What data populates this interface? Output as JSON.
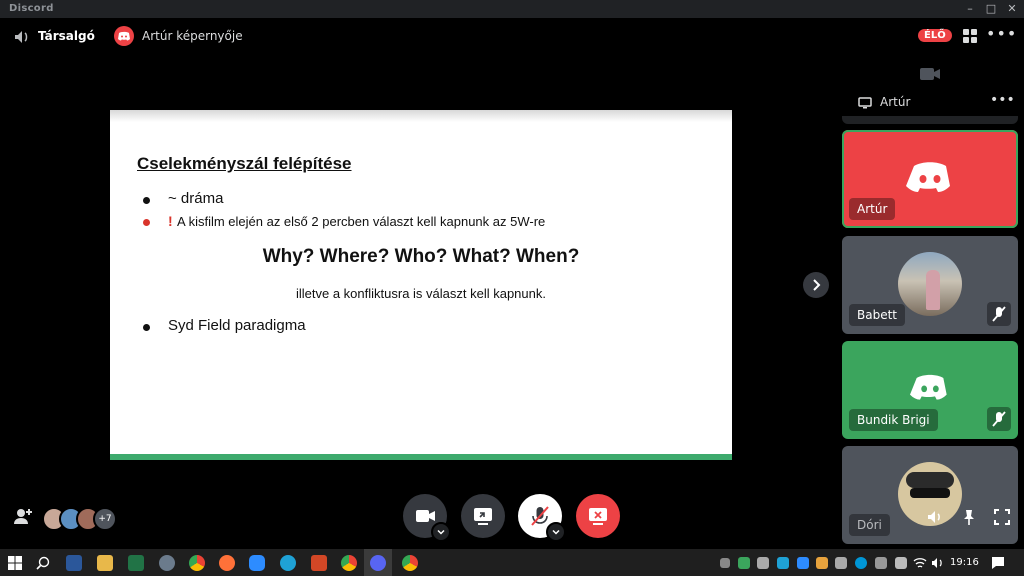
{
  "window": {
    "app_name": "Discord"
  },
  "header": {
    "channel_name": "Társalgó",
    "screen_title": "Artúr képernyője",
    "live_badge": "ÉLŐ"
  },
  "slide": {
    "title": "Cselekményszál felépítése",
    "bullets": [
      {
        "text": "~ dráma"
      },
      {
        "marker": "!",
        "text": "A kisfilm elején az első 2 percben választ kell kapnunk az 5W-re"
      }
    ],
    "headline": "Why? Where? Who? What? When?",
    "subline": "illetve a konfliktusra is választ kell kapnunk.",
    "last_bullet": "Syd Field paradigma",
    "colors": {
      "accent_bar": "#3daa6d",
      "red_bullet": "#d9342b"
    }
  },
  "sidebar": {
    "stream_label": "Artúr",
    "participants": [
      {
        "name": "Artúr",
        "bg": "#ed4245"
      },
      {
        "name": "Babett",
        "bg": "#4f545c"
      },
      {
        "name": "Bundik Brigi",
        "bg": "#3ba55d"
      },
      {
        "name": "Dóri",
        "bg": "#4f545c"
      }
    ]
  },
  "bottom": {
    "extra_count": "+7"
  },
  "taskbar": {
    "time": "19:16"
  },
  "colors": {
    "discord_red": "#ed4245",
    "discord_green": "#3ba55d",
    "titlebar": "#202225"
  }
}
